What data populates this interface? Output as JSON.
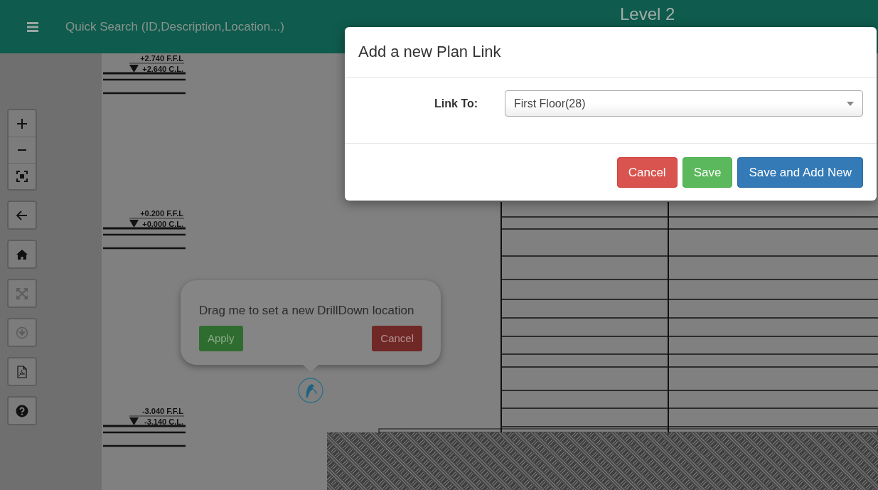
{
  "header": {
    "search": {
      "placeholder": "Quick Search (ID,Description,Location...)"
    },
    "title": "Level 2"
  },
  "toolbar": [
    {
      "kind": "zoom-in",
      "disabled": false
    },
    {
      "kind": "zoom-out",
      "disabled": false
    },
    {
      "kind": "focus",
      "disabled": false
    },
    {
      "kind": "back",
      "disabled": false
    },
    {
      "kind": "home",
      "disabled": false
    },
    {
      "kind": "expand",
      "disabled": true
    },
    {
      "kind": "download",
      "disabled": true
    },
    {
      "kind": "pdf",
      "disabled": false
    },
    {
      "kind": "help",
      "disabled": false
    }
  ],
  "plan": {
    "elevations": [
      {
        "ffl": "+2.740 F.F.L",
        "cl": "+2.640 C.L."
      },
      {
        "ffl": "+0.200 F.F.L",
        "cl": "+0.000 C.L."
      },
      {
        "ffl": "-3.040 F.F.L",
        "cl": "-3.140 C.L."
      }
    ]
  },
  "drilldown_popover": {
    "message": "Drag me to set a new DrillDown location",
    "apply": "Apply",
    "cancel": "Cancel"
  },
  "modal": {
    "title": "Add a new Plan Link",
    "field": {
      "label": "Link To:",
      "value": "First Floor(28)"
    },
    "buttons": [
      {
        "label": "Cancel",
        "kind": "danger"
      },
      {
        "label": "Save",
        "kind": "success"
      },
      {
        "label": "Save and Add New",
        "kind": "primary"
      }
    ]
  }
}
